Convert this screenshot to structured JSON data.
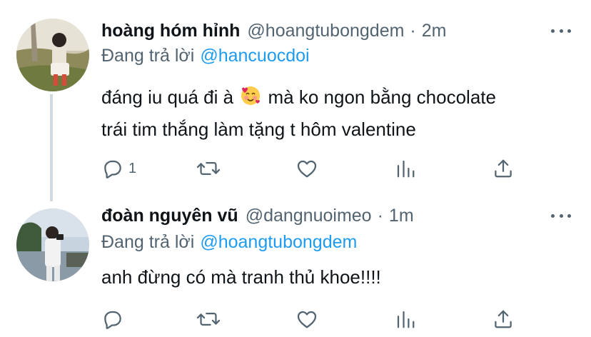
{
  "replies": [
    {
      "display_name": "hoàng hóm hỉnh",
      "handle": "@hoangtubongdem",
      "separator": "·",
      "time": "2m",
      "replying_to_label": "Đang trả lời",
      "replying_to_handle": "@hancuocdoi",
      "text_line1_before_emoji": "đáng iu quá đi à",
      "emoji": "smiling-face-with-hearts",
      "text_line1_after_emoji": "mà ko ngon bằng chocolate",
      "text_line2": "trái tim thắng làm tặng t hôm valentine",
      "reply_count": "1",
      "avatar": "photo of person sitting on grass near a tree"
    },
    {
      "display_name": "đoàn nguyên vũ",
      "handle": "@dangnuoimeo",
      "separator": "·",
      "time": "1m",
      "replying_to_label": "Đang trả lời",
      "replying_to_handle": "@hoangtubongdem",
      "text": "anh đừng có mà tranh thủ khoe!!!!",
      "reply_count": "",
      "avatar": "photo of person taking a selfie by a river"
    }
  ],
  "icons": {
    "reply": "speech-bubble-icon",
    "retweet": "retweet-arrows-icon",
    "like": "heart-outline-icon",
    "stats": "bar-chart-icon",
    "share": "share-upload-icon",
    "more": "more-dots-icon"
  },
  "colors": {
    "text": "#0f1419",
    "secondary": "#536471",
    "link": "#1d9bf0",
    "thread_line": "#cfd9de"
  }
}
